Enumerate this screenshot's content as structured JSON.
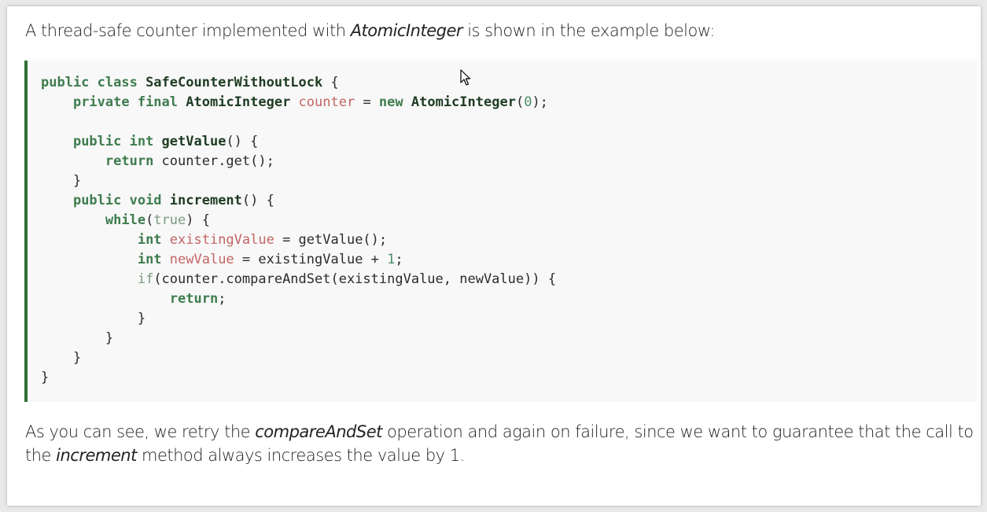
{
  "intro": {
    "text_before": "A thread-safe counter implemented with ",
    "emphasis": "AtomicInteger",
    "text_after": " is shown in the example below:"
  },
  "code": {
    "language": "java",
    "lines": [
      "public class SafeCounterWithoutLock {",
      "    private final AtomicInteger counter = new AtomicInteger(0);",
      "",
      "    public int getValue() {",
      "        return counter.get();",
      "    }",
      "    public void increment() {",
      "        while(true) {",
      "            int existingValue = getValue();",
      "            int newValue = existingValue + 1;",
      "            if(counter.compareAndSet(existingValue, newValue)) {",
      "                return;",
      "            }",
      "        }",
      "    }",
      "}"
    ]
  },
  "outro": {
    "text_1": "As you can see, we retry the ",
    "emphasis_1": "compareAndSet",
    "text_2": " operation and again on failure, since we want to guarantee that the call to the ",
    "emphasis_2": "increment",
    "text_3": " method always increases the value by 1."
  },
  "colors": {
    "accent_border": "#2f6f36",
    "keyword": "#3e7c4e",
    "variable": "#c46464",
    "code_background": "#f8f8f8"
  },
  "icons": {
    "cursor": "mouse-pointer-icon"
  }
}
